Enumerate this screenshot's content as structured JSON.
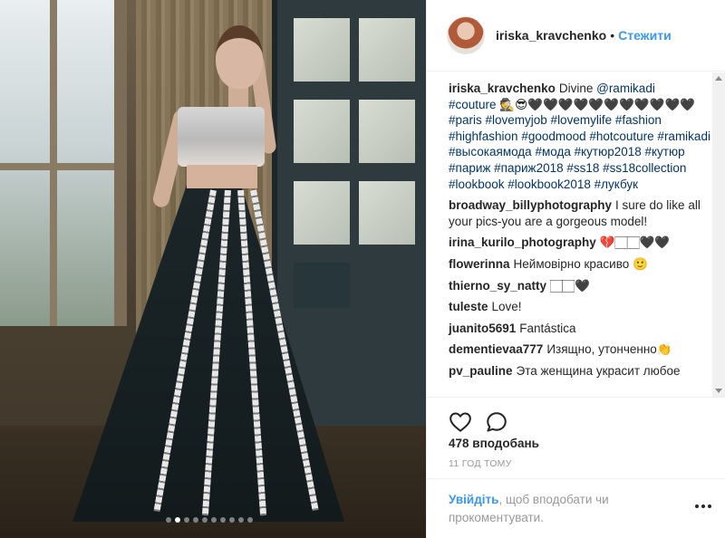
{
  "header": {
    "username": "iriska_kravchenko",
    "separator": "•",
    "follow_label": "Стежити"
  },
  "caption": {
    "user": "iriska_kravchenko",
    "pre": "Divine ",
    "mention": "@ramikadi",
    "line_tags_1": "#couture",
    "emoji_line": " 🕵️😎🖤🖤🖤🖤🖤🖤🖤🖤🖤🖤🖤",
    "tags": "#paris #lovemyjob #lovemylife #fashion #highfashion #goodmood #hotcouture #ramikadi #высокаямода #мода #кутюр2018 #кутюр #париж #париж2018 #ss18 #ss18collection #lookbook #lookbook2018 #лукбук"
  },
  "comments": [
    {
      "user": "broadway_billyphotography",
      "text": "I sure do like all your pics-you are a gorgeous model!"
    },
    {
      "user": "irina_kurilo_photography",
      "text": "💔🏻🏻🖤🖤"
    },
    {
      "user": "flowerinna",
      "text": "Неймовірно красиво 🙂"
    },
    {
      "user": "thierno_sy_natty",
      "text": "🏻🏻🖤"
    },
    {
      "user": "tuleste",
      "text": "Love!"
    },
    {
      "user": "juanito5691",
      "text": "Fantástica"
    },
    {
      "user": "dementievaa777",
      "text": "Изящно, утонченно👏"
    },
    {
      "user": "pv_pauline",
      "text": "Эта женщина украсит любое"
    }
  ],
  "actions": {
    "like_icon": "heart-outline-icon",
    "comment_icon": "speech-bubble-icon"
  },
  "likes_text": "478 вподобань",
  "time_text": "11 ГОД ТОМУ",
  "login": {
    "link": "Увійдіть",
    "rest": ", щоб вподобати чи прокоментувати."
  },
  "carousel": {
    "total": 10,
    "active_index": 1
  },
  "colors": {
    "link_blue": "#3897f0",
    "tag_blue": "#003569",
    "text": "#262626",
    "muted": "#999999"
  }
}
